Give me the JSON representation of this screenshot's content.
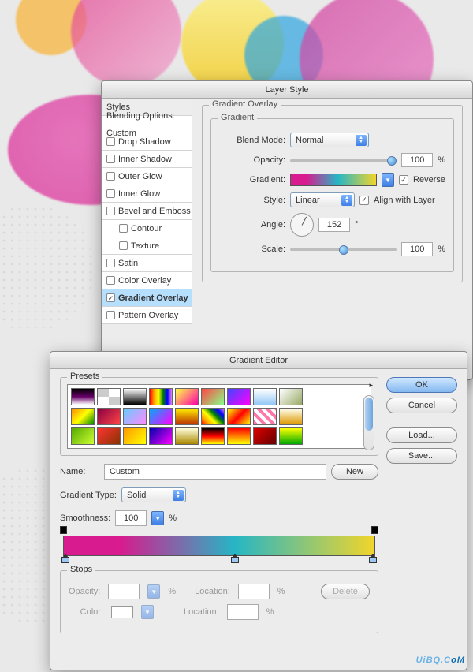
{
  "layerStyle": {
    "title": "Layer Style",
    "sidebar": {
      "header": "Styles",
      "blending": "Blending Options: Custom",
      "items": [
        {
          "label": "Drop Shadow",
          "checked": false
        },
        {
          "label": "Inner Shadow",
          "checked": false
        },
        {
          "label": "Outer Glow",
          "checked": false
        },
        {
          "label": "Inner Glow",
          "checked": false
        },
        {
          "label": "Bevel and Emboss",
          "checked": false
        },
        {
          "label": "Contour",
          "checked": false,
          "indent": true
        },
        {
          "label": "Texture",
          "checked": false,
          "indent": true
        },
        {
          "label": "Satin",
          "checked": false
        },
        {
          "label": "Color Overlay",
          "checked": false
        },
        {
          "label": "Gradient Overlay",
          "checked": true,
          "selected": true
        },
        {
          "label": "Pattern Overlay",
          "checked": false
        }
      ]
    },
    "panel": {
      "title": "Gradient Overlay",
      "groupTitle": "Gradient",
      "blendModeLabel": "Blend Mode:",
      "blendMode": "Normal",
      "opacityLabel": "Opacity:",
      "opacity": "100",
      "opacityUnit": "%",
      "opacitySliderPct": 100,
      "gradientLabel": "Gradient:",
      "reverseLabel": "Reverse",
      "reverseChecked": true,
      "styleLabel": "Style:",
      "style": "Linear",
      "alignLabel": "Align with Layer",
      "alignChecked": true,
      "angleLabel": "Angle:",
      "angle": "152",
      "angleUnit": "°",
      "scaleLabel": "Scale:",
      "scale": "100",
      "scaleUnit": "%",
      "scaleSliderPct": 50
    }
  },
  "gradientEditor": {
    "title": "Gradient Editor",
    "presetsLabel": "Presets",
    "buttons": {
      "ok": "OK",
      "cancel": "Cancel",
      "load": "Load...",
      "save": "Save...",
      "new": "New",
      "delete": "Delete"
    },
    "nameLabel": "Name:",
    "name": "Custom",
    "typeLabel": "Gradient Type:",
    "type": "Solid",
    "smoothLabel": "Smoothness:",
    "smooth": "100",
    "smoothUnit": "%",
    "stopsLabel": "Stops",
    "opacityLabel": "Opacity:",
    "opacityUnit": "%",
    "locationLabel": "Location:",
    "locationUnit": "%",
    "colorLabel": "Color:",
    "gradientStops": [
      {
        "pos": 0,
        "color": "#d81b8e"
      },
      {
        "pos": 55,
        "color": "#26b6c5"
      },
      {
        "pos": 100,
        "color": "#f1d52b"
      }
    ],
    "presets": [
      "linear-gradient(#000,#690069,#fff)",
      "repeating-conic-gradient(#fff 0 25%,#ccc 0 50%)",
      "linear-gradient(#fff,#000)",
      "linear-gradient(90deg,red,orange,yellow,green,blue,violet)",
      "linear-gradient(135deg,#ff4,#f0a)",
      "linear-gradient(135deg,#f44,#8f8)",
      "linear-gradient(135deg,#44f,#f0f)",
      "linear-gradient(#fff,#94c7f7)",
      "linear-gradient(135deg,#fff,#9a6)",
      "linear-gradient(135deg,#f80,#ff0,#080)",
      "linear-gradient(135deg,#804,#f44)",
      "linear-gradient(135deg,#6cf,#f8f)",
      "linear-gradient(135deg,#0af,#f0f)",
      "linear-gradient(#fe0,#b30)",
      "linear-gradient(45deg,red,orange,yellow,green,blue,violet)",
      "linear-gradient(135deg,#ff0,#f00,#ff0)",
      "repeating-linear-gradient(45deg,#f7a 0 4px,#fff 4px 8px)",
      "linear-gradient(#ffe,#d90)",
      "linear-gradient(135deg,#5a0,#cf3)",
      "linear-gradient(135deg,#f33,#830)",
      "linear-gradient(135deg,#f90,#ff0)",
      "linear-gradient(135deg,#00a,#f0f)",
      "linear-gradient(#ffd,#a80)",
      "linear-gradient(#000,#f00,#ff0)",
      "linear-gradient(#f00,#ff0)",
      "linear-gradient(135deg,#d00,#600)",
      "linear-gradient(#ff0,#0a0)"
    ]
  },
  "watermark": {
    "a": "UiB",
    "b": "Q.C",
    "c": "oM"
  }
}
